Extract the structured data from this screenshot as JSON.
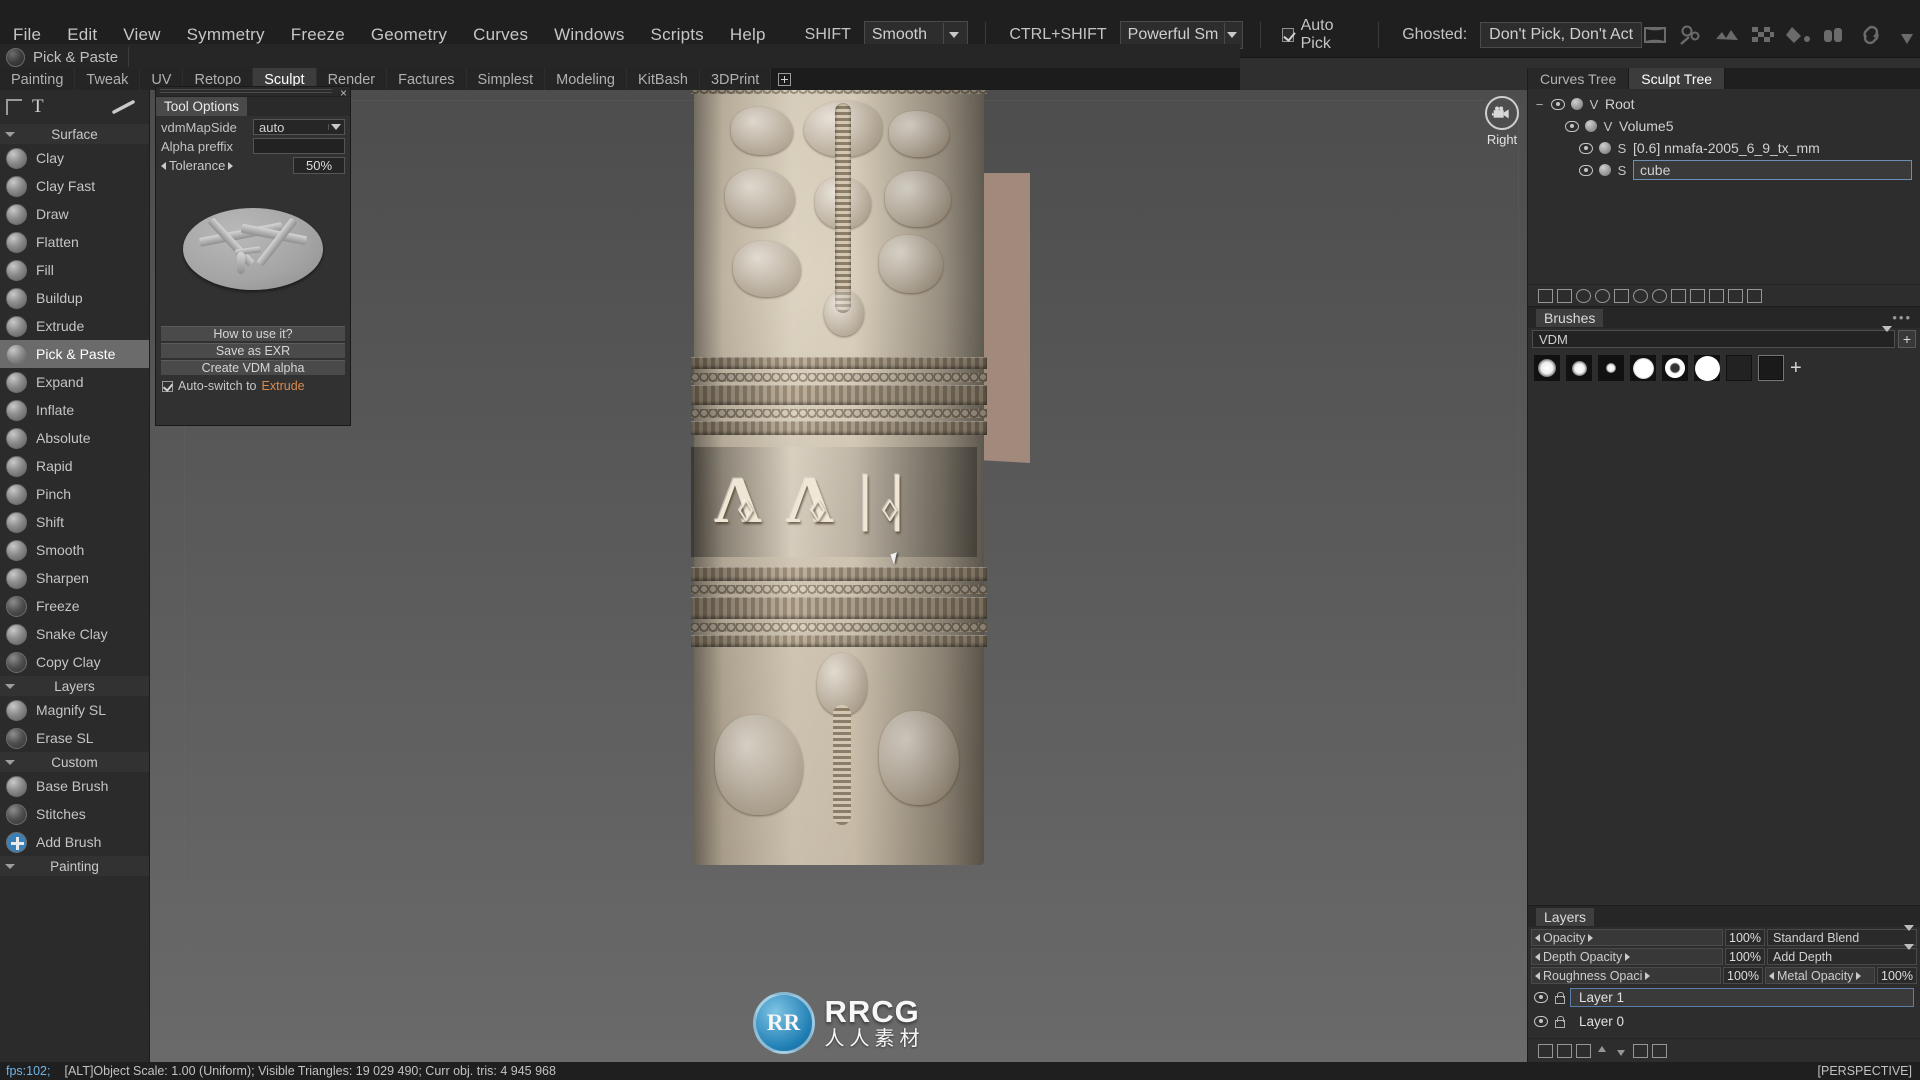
{
  "menu": {
    "items": [
      "File",
      "Edit",
      "View",
      "Symmetry",
      "Freeze",
      "Geometry",
      "Curves",
      "Windows",
      "Scripts",
      "Help"
    ],
    "shift_label": "SHIFT",
    "shift_value": "Smooth",
    "ctrlshift_label": "CTRL+SHIFT",
    "ctrlshift_value": "Powerful Sm",
    "autopick_label": "Auto Pick",
    "ghosted_label": "Ghosted:",
    "ghosted_value": "Don't Pick, Don't Act",
    "icons": [
      "frame-icon",
      "gears-icon",
      "brush-strokes-icon",
      "checker-icon",
      "paint-bucket-icon",
      "material-rolls-icon",
      "link-icon",
      "pin-icon",
      "pen-icon"
    ]
  },
  "current_tool": {
    "name": "Pick & Paste",
    "icon": "tool-ball-icon"
  },
  "tabs": {
    "items": [
      "Painting",
      "Tweak",
      "UV",
      "Retopo",
      "Sculpt",
      "Render",
      "Factures",
      "Simplest",
      "Modeling",
      "KitBash",
      "3DPrint"
    ],
    "active": "Sculpt",
    "add_label": "add-tab-icon"
  },
  "left_toolbar": {
    "header": {
      "text_tool": "T",
      "corner_icon": "corner-crop-icon",
      "stroke_icon": "stroke-icon"
    },
    "sections": [
      {
        "title": "Surface",
        "tools": [
          {
            "label": "Clay",
            "icon": "clay-brush-icon"
          },
          {
            "label": "Clay Fast",
            "icon": "clay-fast-brush-icon"
          },
          {
            "label": "Draw",
            "icon": "draw-brush-icon"
          },
          {
            "label": "Flatten",
            "icon": "flatten-brush-icon"
          },
          {
            "label": "Fill",
            "icon": "fill-brush-icon"
          },
          {
            "label": "Buildup",
            "icon": "buildup-brush-icon"
          },
          {
            "label": "Extrude",
            "icon": "extrude-brush-icon"
          },
          {
            "label": "Pick & Paste",
            "icon": "pick-paste-brush-icon",
            "selected": true
          },
          {
            "label": "Expand",
            "icon": "expand-brush-icon"
          },
          {
            "label": "Inflate",
            "icon": "inflate-brush-icon"
          },
          {
            "label": "Absolute",
            "icon": "absolute-brush-icon"
          },
          {
            "label": "Rapid",
            "icon": "rapid-brush-icon"
          },
          {
            "label": "Pinch",
            "icon": "pinch-brush-icon"
          },
          {
            "label": "Shift",
            "icon": "shift-brush-icon"
          },
          {
            "label": "Smooth",
            "icon": "smooth-brush-icon"
          },
          {
            "label": "Sharpen",
            "icon": "sharpen-brush-icon"
          },
          {
            "label": "Freeze",
            "icon": "freeze-brush-icon"
          },
          {
            "label": "Snake Clay",
            "icon": "snake-clay-brush-icon"
          },
          {
            "label": "Copy Clay",
            "icon": "copy-clay-brush-icon"
          }
        ]
      },
      {
        "title": "Layers",
        "tools": [
          {
            "label": "Magnify SL",
            "icon": "magnify-sl-icon"
          },
          {
            "label": "Erase SL",
            "icon": "erase-sl-icon"
          }
        ]
      },
      {
        "title": "Custom",
        "tools": [
          {
            "label": "Base Brush",
            "icon": "base-brush-icon"
          },
          {
            "label": "Stitches",
            "icon": "stitches-brush-icon"
          },
          {
            "label": "Add Brush",
            "icon": "add-brush-icon"
          }
        ]
      },
      {
        "title": "Painting",
        "tools": []
      }
    ]
  },
  "tool_options": {
    "title": "Tool Options",
    "vdm_map_side_label": "vdmMapSide",
    "vdm_map_side_value": "auto",
    "alpha_prefix_label": "Alpha preffix",
    "alpha_prefix_value": "",
    "tolerance_label": "Tolerance",
    "tolerance_value": "50%",
    "preview_icon": "vdm-alpha-preview",
    "buttons": [
      "How to use it?",
      "Save as EXR",
      "Create VDM alpha"
    ],
    "autoswitch_prefix": "Auto-switch to",
    "autoswitch_target": "Extrude",
    "close_icon": "close-icon"
  },
  "viewport": {
    "view_label": "Right",
    "camera_icon": "camera-icon",
    "close_icon": "close-icon",
    "watermark": {
      "logo": "RR",
      "main": "RRCG",
      "sub": "人人素材"
    },
    "cursor": "mouse-cursor"
  },
  "right_panel": {
    "tabs": [
      {
        "label": "Curves Tree",
        "active": false
      },
      {
        "label": "Sculpt Tree",
        "active": true
      }
    ],
    "tree": [
      {
        "collapse": "−",
        "eye": true,
        "ball": true,
        "type": "V",
        "name": "Root",
        "boxed": false,
        "indent": 0
      },
      {
        "collapse": "",
        "eye": true,
        "ball": true,
        "type": "V",
        "name": "Volume5",
        "boxed": false,
        "indent": 1
      },
      {
        "collapse": "",
        "eye": true,
        "ball": true,
        "type": "S",
        "name": "[0.6]  nmafa-2005_6_9_tx_mm",
        "boxed": false,
        "indent": 2
      },
      {
        "collapse": "",
        "eye": true,
        "ball": true,
        "type": "S",
        "name": "cube",
        "boxed": true,
        "indent": 2
      }
    ],
    "tree_toolbar_icons": [
      "add-volume-icon",
      "duplicate-icon",
      "sphere-primitive-icon",
      "cylinder-primitive-icon",
      "merge-icon",
      "ghost-icon",
      "info-icon",
      "list-icon",
      "page-icon",
      "copy-icon",
      "delete-icon",
      "export-icon"
    ],
    "brushes": {
      "title": "Brushes",
      "dots": "•••",
      "selected": "VDM",
      "add_label": "+",
      "items": [
        "alpha-soft-round",
        "alpha-medium-round",
        "alpha-small-round",
        "alpha-bright-round",
        "alpha-ring",
        "alpha-solid-white",
        "alpha-dark-round",
        "alpha-square"
      ],
      "add_brush_icon": "add-brush-plus-icon"
    },
    "layers": {
      "title": "Layers",
      "rows": [
        {
          "label": "Opacity",
          "value": "100%",
          "combo": "Standard Blend"
        },
        {
          "label": "Depth Opacity",
          "value": "100%",
          "combo": "Add Depth"
        },
        {
          "label": "Roughness Opaci",
          "value": "100%",
          "combo_label": "Metal Opacity",
          "combo_value": "100%"
        }
      ],
      "items": [
        {
          "name": "Layer 1",
          "selected": true
        },
        {
          "name": "Layer 0",
          "selected": false
        }
      ],
      "toolbar_icons": [
        "add-layer-icon",
        "duplicate-layer-icon",
        "merge-down-icon",
        "move-up-icon",
        "move-down-icon",
        "clear-layer-icon",
        "delete-layer-icon"
      ]
    }
  },
  "status_bar": {
    "fps": "fps:102;",
    "main": "[ALT]Object Scale: 1.00 (Uniform);  Visible Triangles: 19 029 490;  Curr obj. tris: 4 945 968",
    "right": "[PERSPECTIVE]"
  },
  "colors": {
    "accent_blue": "#6fb4e8",
    "selection": "#6b6b6b",
    "panel_bg": "#2d2d2d",
    "orange": "#d98a4e"
  }
}
